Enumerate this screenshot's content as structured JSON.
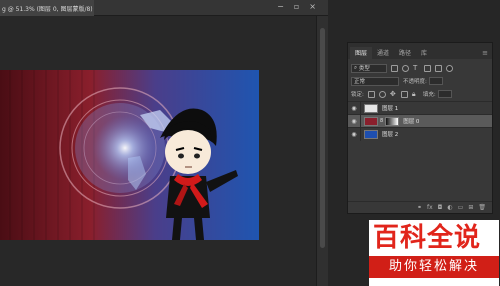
{
  "document": {
    "tab_title": "g @ 51.3% (图层 0, 图层蒙版/8) *",
    "window_buttons": [
      "minimize-icon",
      "restore-icon",
      "close-icon"
    ]
  },
  "layers_panel": {
    "tabs": [
      {
        "label": "图层",
        "active": true
      },
      {
        "label": "通道",
        "active": false
      },
      {
        "label": "路径",
        "active": false
      },
      {
        "label": "库",
        "active": false
      }
    ],
    "filter_label": "类型",
    "blend_mode": "正常",
    "opacity_label": "不透明度:",
    "lock_label": "锁定:",
    "fill_label": "填充:",
    "layers": [
      {
        "name": "图层 1",
        "visible": true,
        "selected": false
      },
      {
        "name": "图层 0",
        "visible": true,
        "selected": true
      },
      {
        "name": "图层 2",
        "visible": true,
        "selected": false
      }
    ]
  },
  "watermark": {
    "title": "百科全说",
    "subtitle": "助你轻松解决"
  },
  "colors": {
    "accent_red": "#e1251b",
    "layer_blue": "#1e4fb0",
    "selected_row": "#5a5a5a"
  }
}
